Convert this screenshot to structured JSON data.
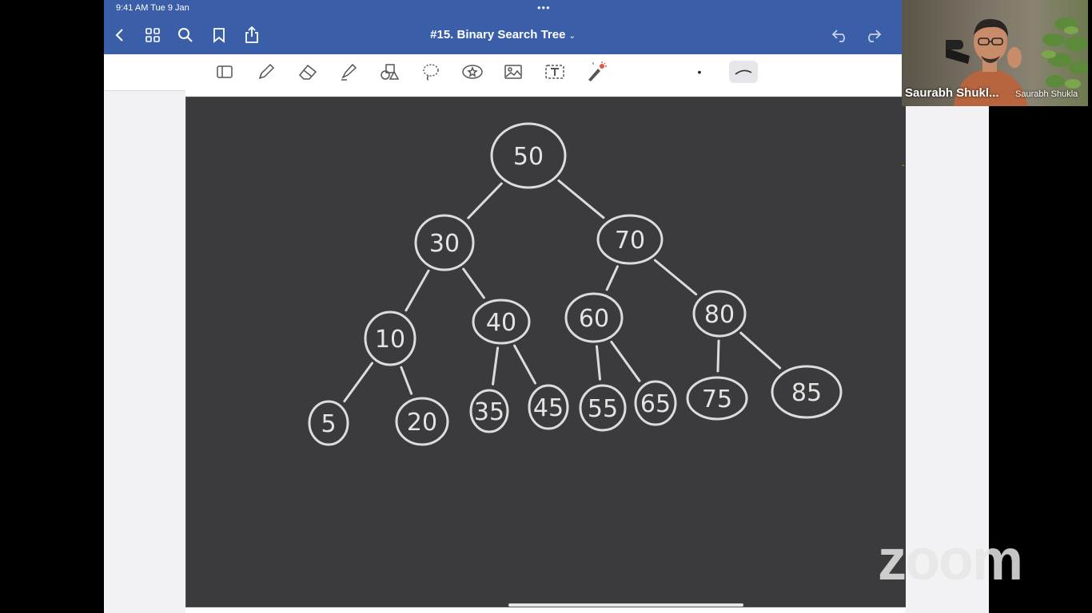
{
  "statusbar": {
    "time": "9:41 AM   Tue 9 Jan",
    "dots": "•••"
  },
  "navbar": {
    "title": "#15. Binary Search Tree",
    "title_caret": "⌄",
    "icons": [
      "back-icon",
      "grid-icon",
      "search-icon",
      "bookmark-icon",
      "share-icon",
      "undo-icon",
      "redo-icon"
    ]
  },
  "toolbar": {
    "tools": [
      "reader-icon",
      "pen-icon",
      "eraser-icon",
      "highlighter-icon",
      "shapes-icon",
      "lasso-icon",
      "sticker-icon",
      "image-icon",
      "text-icon",
      "laser-pointer-icon"
    ],
    "stroke_dot": "•"
  },
  "tree": {
    "nodes": [
      {
        "id": "n50",
        "label": "50"
      },
      {
        "id": "n30",
        "label": "30"
      },
      {
        "id": "n70",
        "label": "70"
      },
      {
        "id": "n10",
        "label": "10"
      },
      {
        "id": "n40",
        "label": "40"
      },
      {
        "id": "n60",
        "label": "60"
      },
      {
        "id": "n80",
        "label": "80"
      },
      {
        "id": "n5",
        "label": "5"
      },
      {
        "id": "n20",
        "label": "20"
      },
      {
        "id": "n35",
        "label": "35"
      },
      {
        "id": "n45",
        "label": "45"
      },
      {
        "id": "n55",
        "label": "55"
      },
      {
        "id": "n65",
        "label": "65"
      },
      {
        "id": "n75",
        "label": "75"
      },
      {
        "id": "n85",
        "label": "85"
      }
    ],
    "edges": [
      [
        "n50",
        "n30"
      ],
      [
        "n50",
        "n70"
      ],
      [
        "n30",
        "n10"
      ],
      [
        "n30",
        "n40"
      ],
      [
        "n70",
        "n60"
      ],
      [
        "n70",
        "n80"
      ],
      [
        "n10",
        "n5"
      ],
      [
        "n10",
        "n20"
      ],
      [
        "n40",
        "n35"
      ],
      [
        "n40",
        "n45"
      ],
      [
        "n60",
        "n55"
      ],
      [
        "n60",
        "n65"
      ],
      [
        "n80",
        "n75"
      ],
      [
        "n80",
        "n85"
      ]
    ]
  },
  "video": {
    "name_main": "Saurabh Shukl...",
    "name_sub": "Saurabh Shukla"
  },
  "watermark": {
    "text": "zoom"
  },
  "colors": {
    "nav_blue": "#3a5fa8",
    "canvas": "#3b3b3e",
    "ink": "#e4e4e4"
  }
}
